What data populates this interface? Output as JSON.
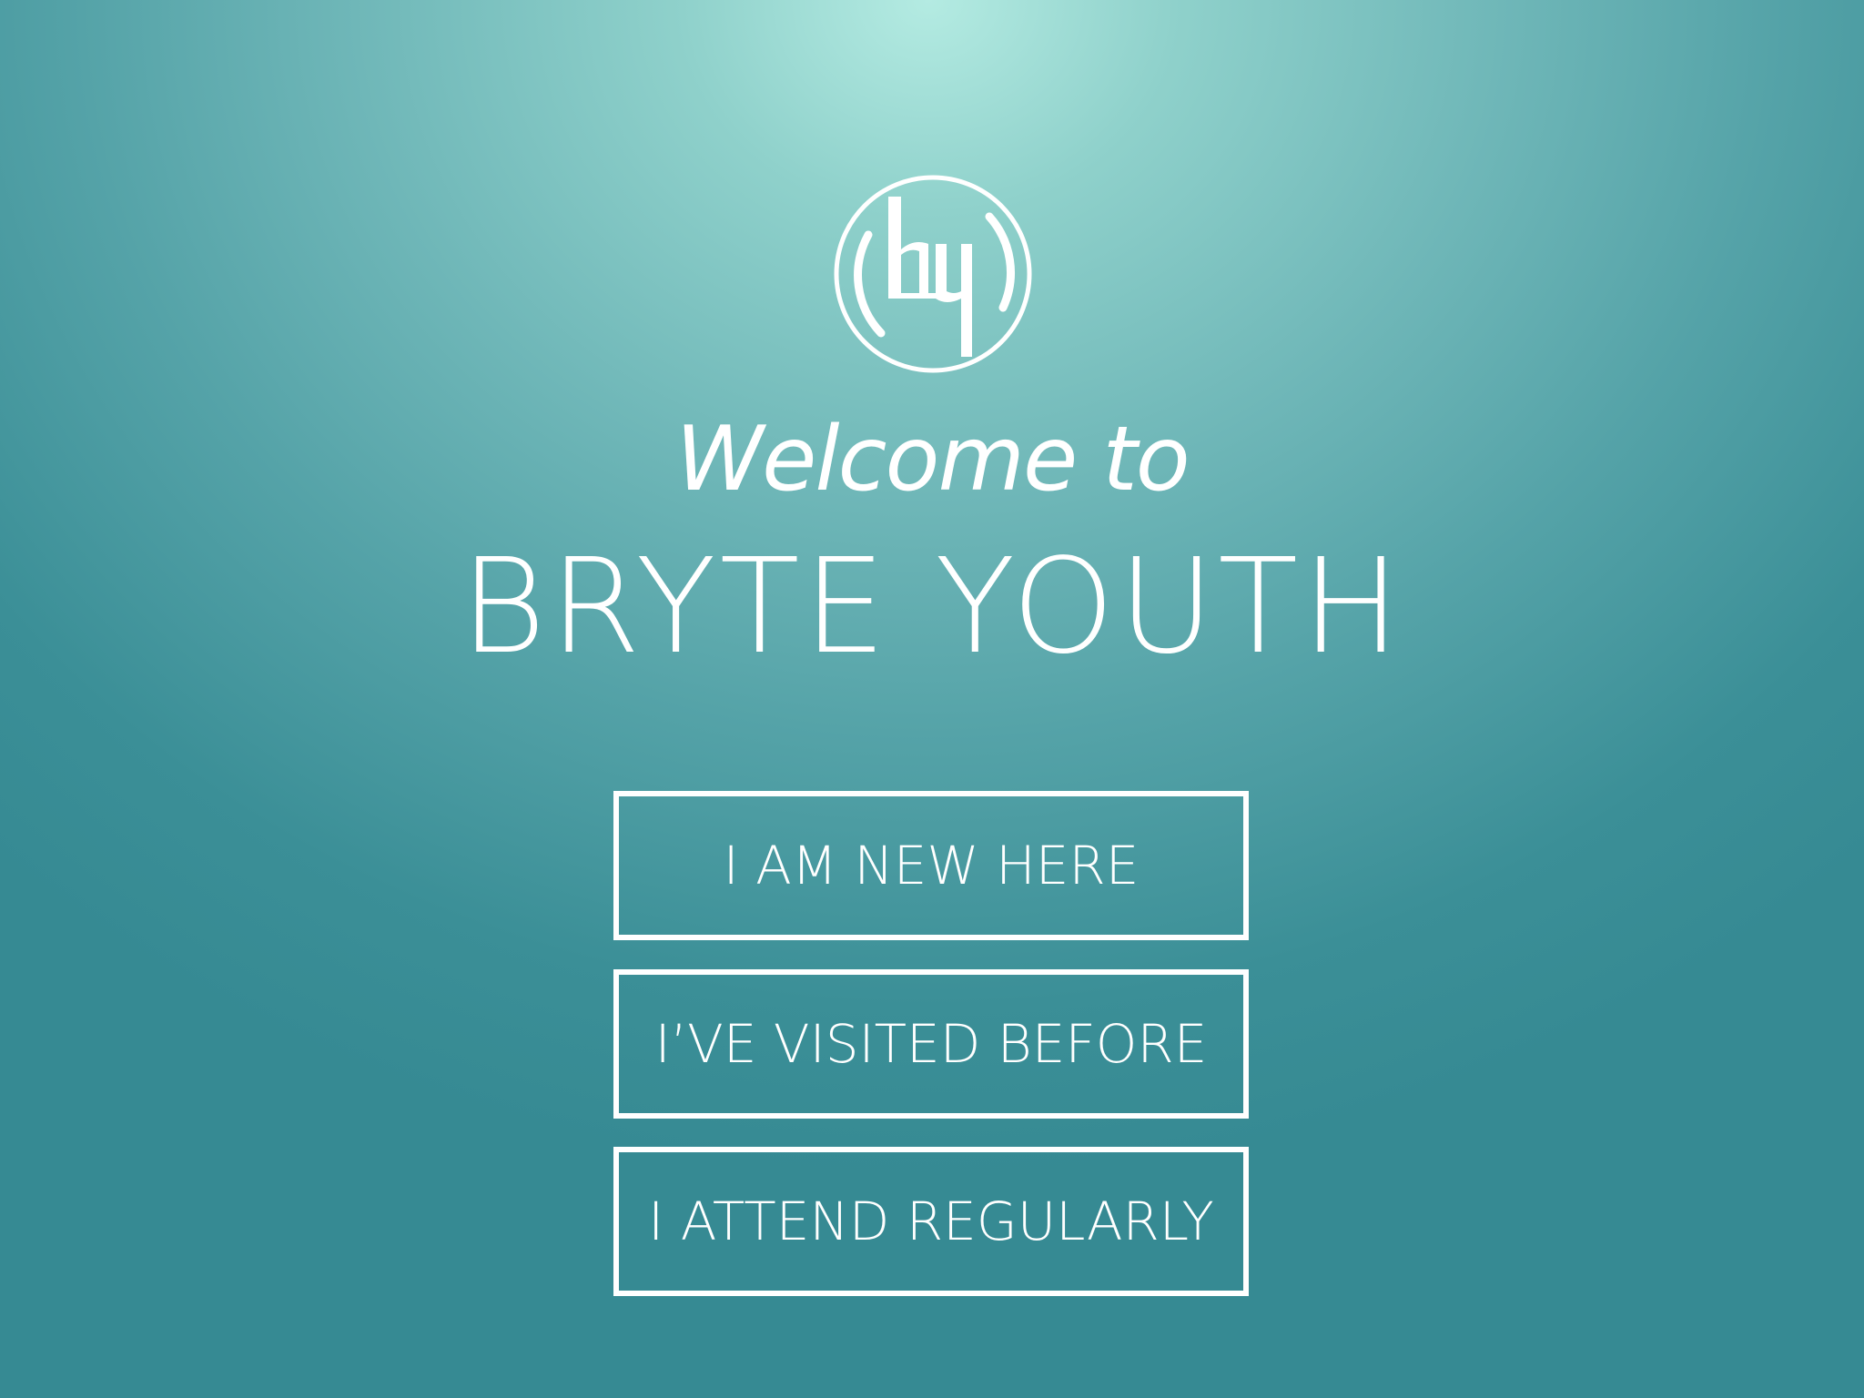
{
  "app": {
    "logo_icon": "by-circle-logo-icon",
    "welcome_text": "Welcome to",
    "brand_name": "BRYTE YOUTH"
  },
  "actions": [
    {
      "label": "I AM NEW HERE"
    },
    {
      "label": "I’VE VISITED BEFORE"
    },
    {
      "label": "I ATTEND REGULARLY"
    }
  ],
  "colors": {
    "background_top": "#b4ebe2",
    "background_bottom": "#368a93",
    "foreground": "#ffffff"
  }
}
